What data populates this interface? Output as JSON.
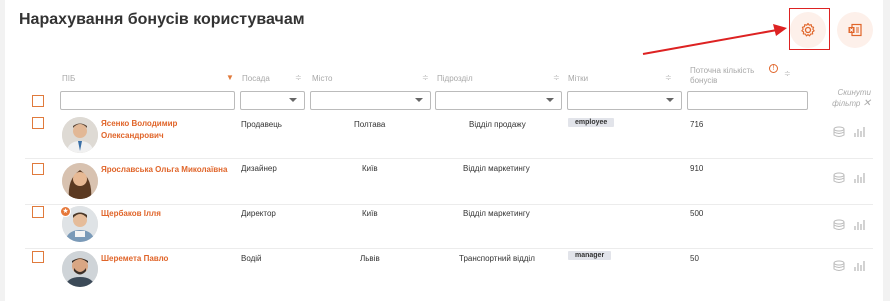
{
  "page": {
    "title": "Нарахування бонусів користувачам"
  },
  "colors": {
    "accent": "#e0652a",
    "annotation": "#d22222"
  },
  "toolbar": {
    "settings_icon": "gear-icon",
    "export_icon": "export-icon"
  },
  "table": {
    "columns": {
      "name": "ПІБ",
      "position": "Посада",
      "city": "Місто",
      "department": "Підрозділ",
      "tags": "Мітки",
      "bonus_line1": "Поточна кількість",
      "bonus_line2": "бонусів"
    },
    "reset_filter_line1": "Скинути",
    "reset_filter_line2": "фільтр",
    "rows": [
      {
        "name_line1": "Ясенко Володимир",
        "name_line2": "Олександрович",
        "position": "Продавець",
        "city": "Полтава",
        "department": "Відділ продажу",
        "tag": "employee",
        "bonus": "716"
      },
      {
        "name_line1": "Ярославська Ольга Миколаївна",
        "name_line2": "",
        "position": "Дизайнер",
        "city": "Київ",
        "department": "Відділ маркетингу",
        "tag": "",
        "bonus": "910"
      },
      {
        "name_line1": "Щербаков Ілля",
        "name_line2": "",
        "position": "Директор",
        "city": "Київ",
        "department": "Відділ маркетингу",
        "tag": "",
        "bonus": "500"
      },
      {
        "name_line1": "Шеремета Павло",
        "name_line2": "",
        "position": "Водій",
        "city": "Львів",
        "department": "Транспортний відділ",
        "tag": "manager",
        "bonus": "50"
      }
    ]
  }
}
